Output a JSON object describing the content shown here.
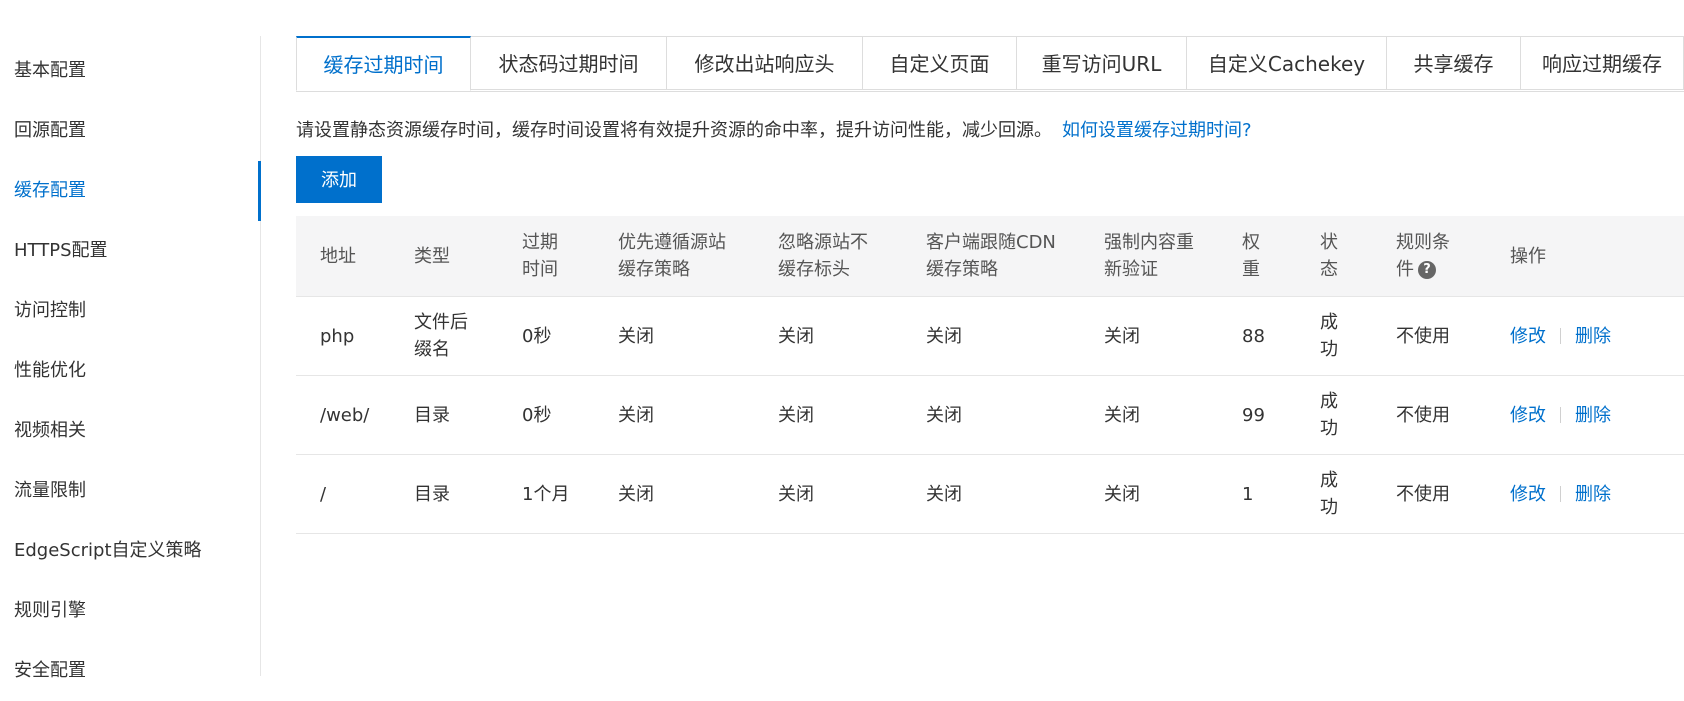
{
  "sidebar": {
    "items": [
      {
        "label": "基本配置",
        "active": false
      },
      {
        "label": "回源配置",
        "active": false
      },
      {
        "label": "缓存配置",
        "active": true
      },
      {
        "label": "HTTPS配置",
        "active": false
      },
      {
        "label": "访问控制",
        "active": false
      },
      {
        "label": "性能优化",
        "active": false
      },
      {
        "label": "视频相关",
        "active": false
      },
      {
        "label": "流量限制",
        "active": false
      },
      {
        "label": "EdgeScript自定义策略",
        "active": false
      },
      {
        "label": "规则引擎",
        "active": false
      },
      {
        "label": "安全配置",
        "active": false
      }
    ]
  },
  "tabs": [
    {
      "label": "缓存过期时间",
      "active": true
    },
    {
      "label": "状态码过期时间",
      "active": false
    },
    {
      "label": "修改出站响应头",
      "active": false
    },
    {
      "label": "自定义页面",
      "active": false
    },
    {
      "label": "重写访问URL",
      "active": false
    },
    {
      "label": "自定义Cachekey",
      "active": false
    },
    {
      "label": "共享缓存",
      "active": false
    },
    {
      "label": "响应过期缓存",
      "active": false
    }
  ],
  "description": {
    "text": "请设置静态资源缓存时间，缓存时间设置将有效提升资源的命中率，提升访问性能，减少回源。",
    "link": "如何设置缓存过期时间?"
  },
  "add_button": "添加",
  "table": {
    "headers": {
      "address": "地址",
      "type": "类型",
      "expire_l1": "过期",
      "expire_l2": "时间",
      "follow_l1": "优先遵循源站",
      "follow_l2": "缓存策略",
      "ignore_l1": "忽略源站不",
      "ignore_l2": "缓存标头",
      "client_l1": "客户端跟随CDN",
      "client_l2": "缓存策略",
      "revalidate_l1": "强制内容重",
      "revalidate_l2": "新验证",
      "weight_l1": "权",
      "weight_l2": "重",
      "status_l1": "状",
      "status_l2": "态",
      "rule_l1": "规则条",
      "rule_l2": "件",
      "action": "操作"
    },
    "help_icon": "?",
    "rows": [
      {
        "address": "php",
        "type_l1": "文件后",
        "type_l2": "缀名",
        "expire": "0秒",
        "follow": "关闭",
        "ignore": "关闭",
        "client": "关闭",
        "revalidate": "关闭",
        "weight": "88",
        "status_l1": "成",
        "status_l2": "功",
        "rule": "不使用",
        "edit": "修改",
        "delete": "删除"
      },
      {
        "address": "/web/",
        "type_l1": "目录",
        "type_l2": "",
        "expire": "0秒",
        "follow": "关闭",
        "ignore": "关闭",
        "client": "关闭",
        "revalidate": "关闭",
        "weight": "99",
        "status_l1": "成",
        "status_l2": "功",
        "rule": "不使用",
        "edit": "修改",
        "delete": "删除"
      },
      {
        "address": "/",
        "type_l1": "目录",
        "type_l2": "",
        "expire": "1个月",
        "follow": "关闭",
        "ignore": "关闭",
        "client": "关闭",
        "revalidate": "关闭",
        "weight": "1",
        "status_l1": "成",
        "status_l2": "功",
        "rule": "不使用",
        "edit": "修改",
        "delete": "删除"
      }
    ]
  },
  "colors": {
    "accent": "#0070cc",
    "header_bg": "#f5f5f6",
    "border": "#e6e6e6"
  }
}
